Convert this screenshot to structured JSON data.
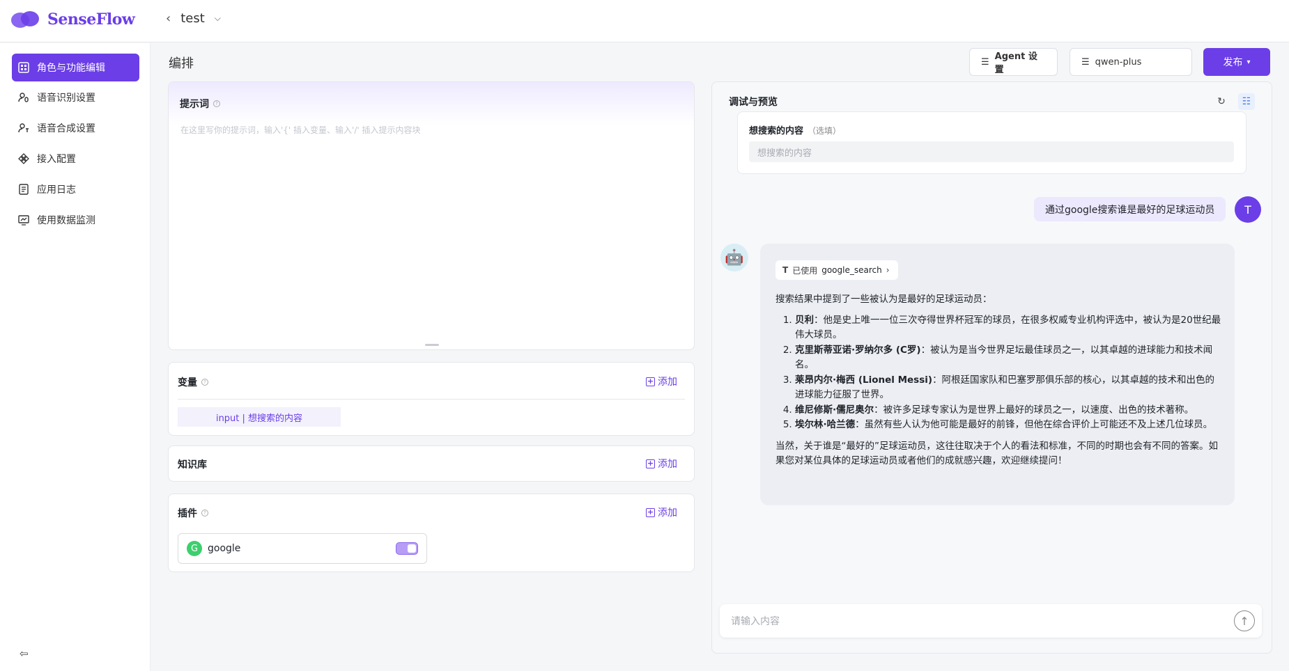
{
  "app": {
    "logo_text": "SenseFlow",
    "brand_color": "#6b3ee8"
  },
  "breadcrumb": {
    "title": "test"
  },
  "sidebar": {
    "items": [
      {
        "label": "角色与功能编辑",
        "icon": "layout-icon",
        "active": true
      },
      {
        "label": "语音识别设置",
        "icon": "speech-recognition-icon",
        "active": false
      },
      {
        "label": "语音合成设置",
        "icon": "speech-synthesis-icon",
        "active": false
      },
      {
        "label": "接入配置",
        "icon": "integration-icon",
        "active": false
      },
      {
        "label": "应用日志",
        "icon": "log-icon",
        "active": false
      },
      {
        "label": "使用数据监测",
        "icon": "monitor-icon",
        "active": false
      }
    ]
  },
  "main": {
    "section_title": "编排",
    "prompt": {
      "title": "提示词",
      "placeholder": "在这里写你的提示词，输入'{' 插入变量、输入'/' 插入提示内容块"
    },
    "variables": {
      "title": "变量",
      "add_label": "添加",
      "items": [
        "input | 想搜索的内容"
      ]
    },
    "knowledge": {
      "title": "知识库",
      "add_label": "添加"
    },
    "plugins": {
      "title": "插件",
      "add_label": "添加",
      "items": [
        {
          "letter": "G",
          "name": "google",
          "enabled": true
        }
      ]
    }
  },
  "header_controls": {
    "agent_settings": "Agent 设置",
    "model": "qwen-plus",
    "publish": "发布"
  },
  "preview": {
    "title": "调试与预览",
    "form": {
      "label": "想搜索的内容",
      "optional": "（选填）",
      "placeholder": "想搜索的内容"
    },
    "user_avatar": "T",
    "user_message": "通过google搜索谁是最好的足球运动员",
    "bot_avatar": "🤖",
    "tool_used_prefix": "已使用",
    "tool_used_name": "google_search",
    "answer_intro": "搜索结果中提到了一些被认为是最好的足球运动员：",
    "answer_list": [
      {
        "name": "贝利",
        "text": "：他是史上唯一一位三次夺得世界杯冠军的球员，在很多权威专业机构评选中，被认为是20世纪最伟大球员。"
      },
      {
        "name": "克里斯蒂亚诺·罗纳尔多 (C罗)",
        "text": "：被认为是当今世界足坛最佳球员之一，以其卓越的进球能力和技术闻名。"
      },
      {
        "name": "莱昂内尔·梅西 (Lionel Messi)",
        "text": "：阿根廷国家队和巴塞罗那俱乐部的核心，以其卓越的技术和出色的进球能力征服了世界。"
      },
      {
        "name": "维尼修斯·儒尼奥尔",
        "text": "：被许多足球专家认为是世界上最好的球员之一，以速度、出色的技术著称。"
      },
      {
        "name": "埃尔林·哈兰德",
        "text": "：虽然有些人认为他可能是最好的前锋，但他在综合评价上可能还不及上述几位球员。"
      }
    ],
    "answer_outro": "当然，关于谁是“最好的”足球运动员，这往往取决于个人的看法和标准，不同的时期也会有不同的答案。如果您对某位具体的足球运动员或者他们的成就感兴趣，欢迎继续提问！",
    "input_placeholder": "请输入内容"
  }
}
